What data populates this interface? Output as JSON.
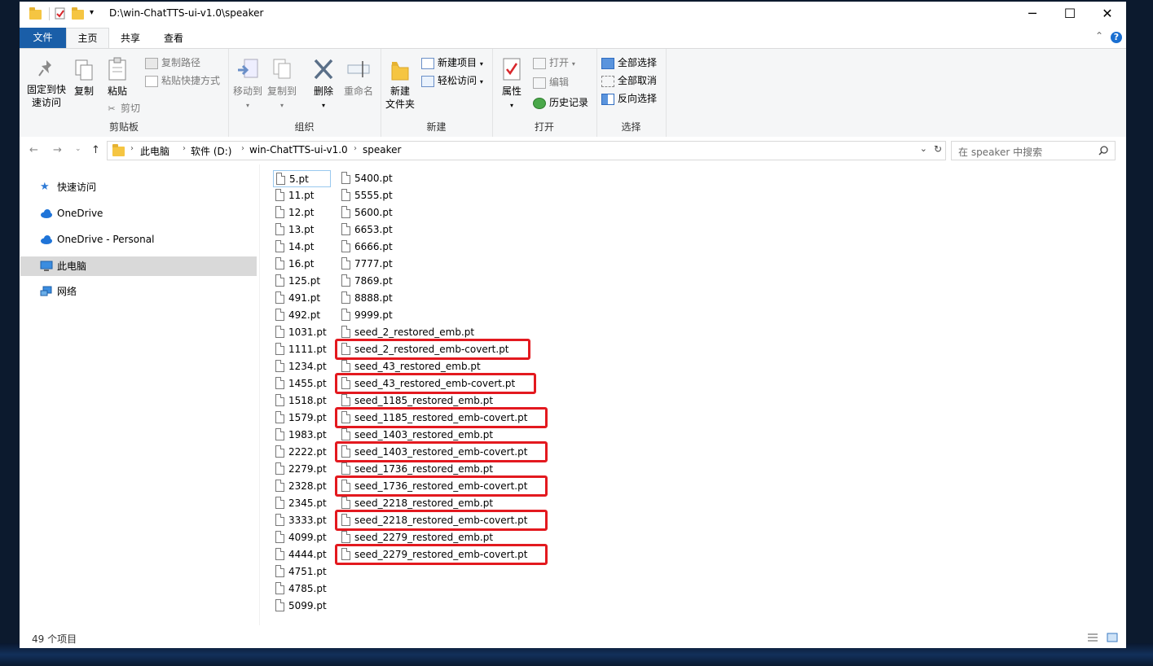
{
  "window": {
    "title": "D:\\win-ChatTTS-ui-v1.0\\speaker"
  },
  "ribbon": {
    "tabs": [
      "文件",
      "主页",
      "共享",
      "查看"
    ],
    "clipboard": {
      "pin_label_1": "固定到快",
      "pin_label_2": "速访问",
      "copy": "复制",
      "paste": "粘贴",
      "copy_path": "复制路径",
      "paste_shortcut": "粘贴快捷方式",
      "cut": "剪切",
      "group": "剪贴板"
    },
    "organize": {
      "move_to": "移动到",
      "copy_to": "复制到",
      "delete": "删除",
      "rename": "重命名",
      "group": "组织"
    },
    "new": {
      "new_folder_1": "新建",
      "new_folder_2": "文件夹",
      "new_item": "新建项目",
      "easy_access": "轻松访问",
      "group": "新建"
    },
    "open": {
      "properties": "属性",
      "open": "打开",
      "edit": "编辑",
      "history": "历史记录",
      "group": "打开"
    },
    "select": {
      "select_all": "全部选择",
      "select_none": "全部取消",
      "invert": "反向选择",
      "group": "选择"
    }
  },
  "address": {
    "crumbs": [
      "此电脑",
      "软件 (D:)",
      "win-ChatTTS-ui-v1.0",
      "speaker"
    ],
    "search_placeholder": "在 speaker 中搜索"
  },
  "nav": {
    "items": [
      "快速访问",
      "OneDrive",
      "OneDrive - Personal",
      "此电脑",
      "网络"
    ],
    "selected": "此电脑"
  },
  "files": {
    "column1": [
      "5.pt",
      "11.pt",
      "12.pt",
      "13.pt",
      "14.pt",
      "16.pt",
      "125.pt",
      "491.pt",
      "492.pt",
      "1031.pt",
      "1111.pt",
      "1234.pt",
      "1455.pt",
      "1518.pt",
      "1579.pt",
      "1983.pt",
      "2222.pt",
      "2279.pt",
      "2328.pt",
      "2345.pt",
      "3333.pt",
      "4099.pt",
      "4444.pt",
      "4751.pt",
      "4785.pt",
      "5099.pt"
    ],
    "column2": [
      "5400.pt",
      "5555.pt",
      "5600.pt",
      "6653.pt",
      "6666.pt",
      "7777.pt",
      "7869.pt",
      "8888.pt",
      "9999.pt",
      "seed_2_restored_emb.pt",
      "seed_2_restored_emb-covert.pt",
      "seed_43_restored_emb.pt",
      "seed_43_restored_emb-covert.pt",
      "seed_1185_restored_emb.pt",
      "seed_1185_restored_emb-covert.pt",
      "seed_1403_restored_emb.pt",
      "seed_1403_restored_emb-covert.pt",
      "seed_1736_restored_emb.pt",
      "seed_1736_restored_emb-covert.pt",
      "seed_2218_restored_emb.pt",
      "seed_2218_restored_emb-covert.pt",
      "seed_2279_restored_emb.pt",
      "seed_2279_restored_emb-covert.pt"
    ],
    "highlighted": [
      "seed_2_restored_emb-covert.pt",
      "seed_43_restored_emb-covert.pt",
      "seed_1185_restored_emb-covert.pt",
      "seed_1403_restored_emb-covert.pt",
      "seed_1736_restored_emb-covert.pt",
      "seed_2218_restored_emb-covert.pt",
      "seed_2279_restored_emb-covert.pt"
    ],
    "focused": "5.pt"
  },
  "status": {
    "count": "49 个项目"
  },
  "colors": {
    "accent": "#1a5ea8",
    "highlight_box": "#e3191f"
  }
}
